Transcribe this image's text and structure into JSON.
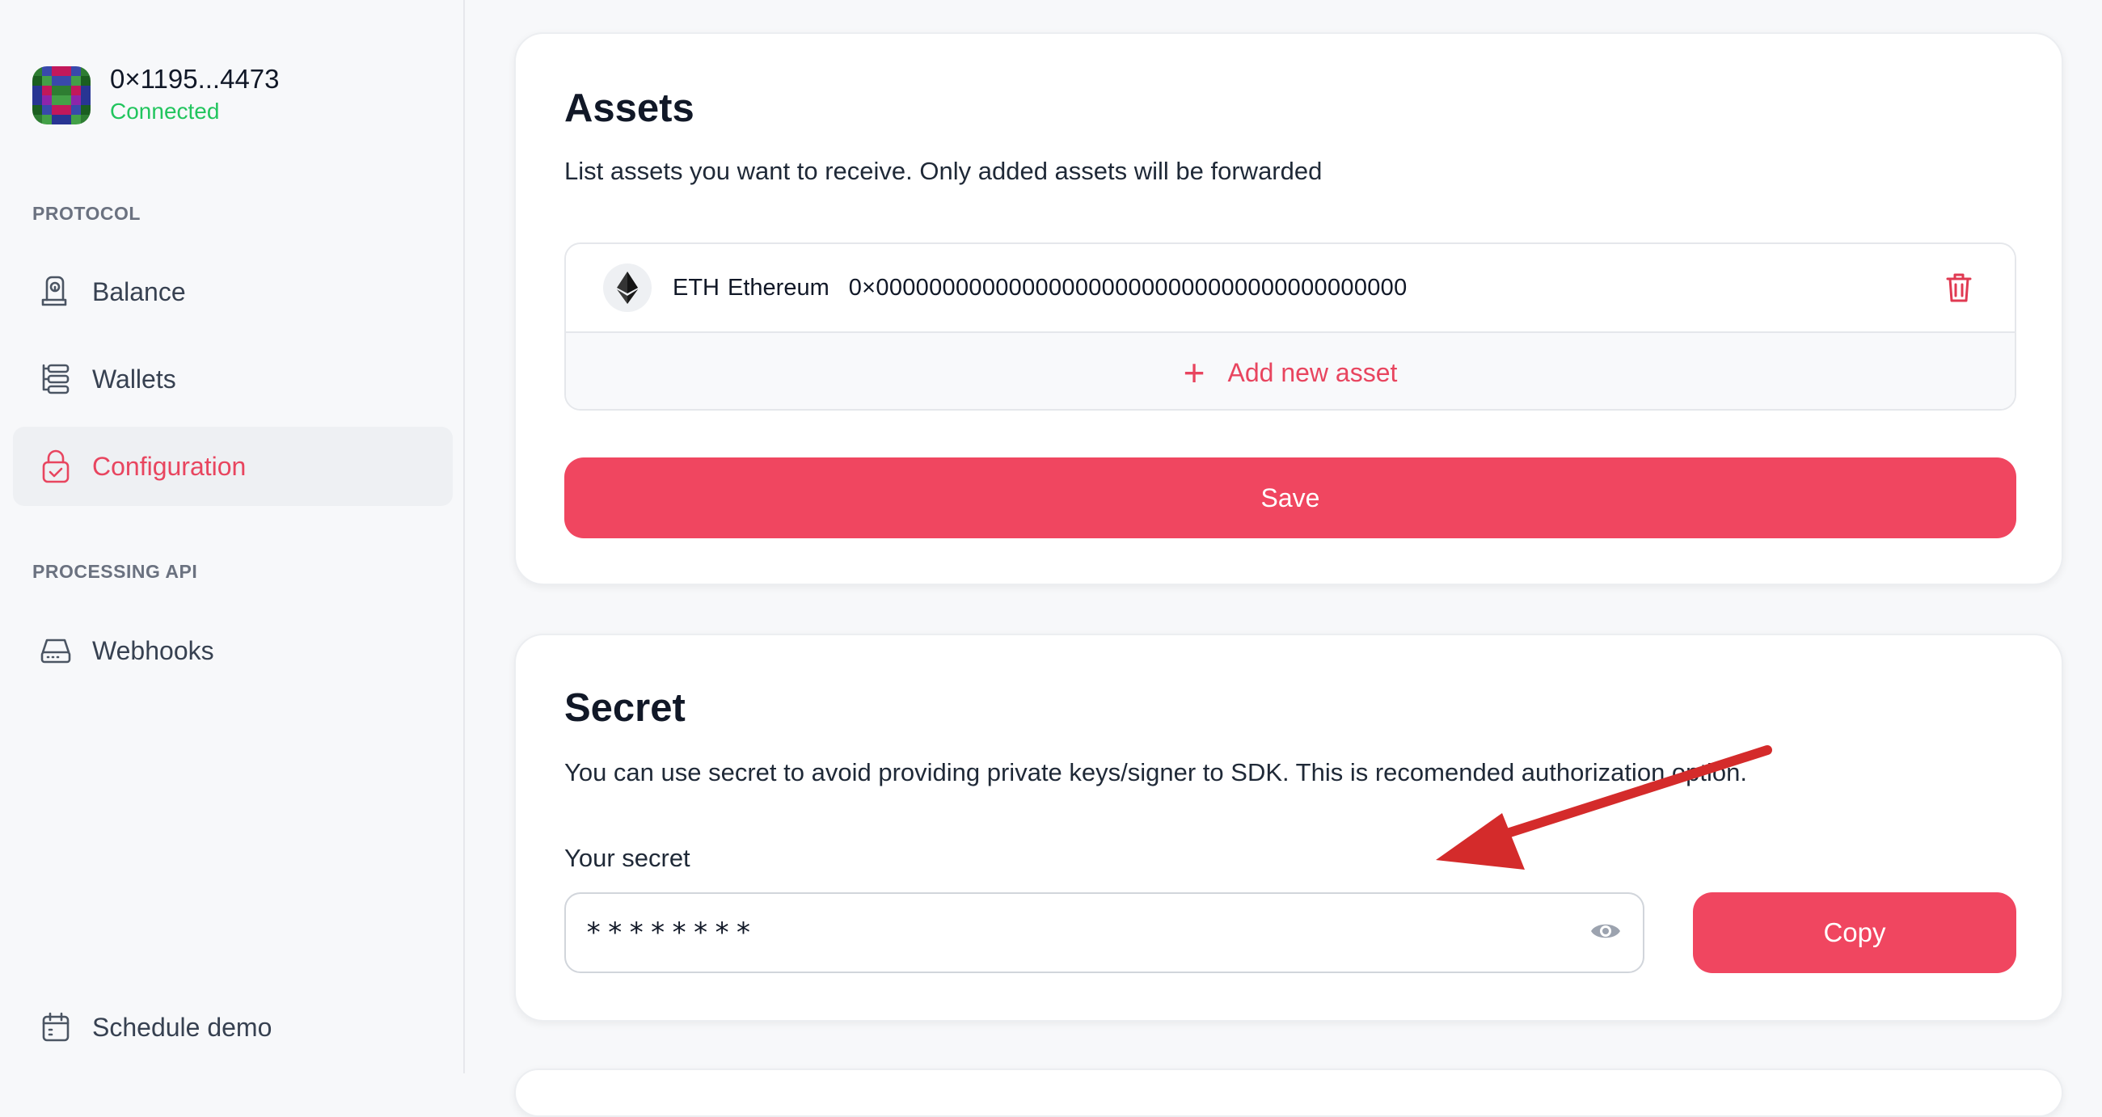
{
  "account": {
    "address": "0×1195...4473",
    "status": "Connected"
  },
  "sidebar": {
    "sections": [
      {
        "label": "PROTOCOL",
        "items": [
          {
            "label": "Balance",
            "icon": "balance-icon"
          },
          {
            "label": "Wallets",
            "icon": "wallets-icon"
          },
          {
            "label": "Configuration",
            "icon": "configuration-lock-icon",
            "active": true
          }
        ]
      },
      {
        "label": "PROCESSING API",
        "items": [
          {
            "label": "Webhooks",
            "icon": "webhooks-icon"
          }
        ]
      }
    ],
    "footer_item": {
      "label": "Schedule demo",
      "icon": "calendar-icon"
    }
  },
  "assets_card": {
    "title": "Assets",
    "description": "List assets you want to receive. Only added assets will be forwarded",
    "assets": [
      {
        "symbol": "ETH",
        "name": "Ethereum",
        "address": "0×0000000000000000000000000000000000000000",
        "icon": "ethereum-icon"
      }
    ],
    "add_label": "Add new asset",
    "save_label": "Save"
  },
  "secret_card": {
    "title": "Secret",
    "description": "You can use secret to avoid providing private keys/signer to SDK. This is recomended authorization option.",
    "field_label": "Your secret",
    "secret_value": "********",
    "copy_label": "Copy"
  },
  "colors": {
    "accent": "#f04660",
    "accent_text": "#e8455f",
    "connected": "#22c55e",
    "annotation_arrow": "#d42b2b"
  }
}
